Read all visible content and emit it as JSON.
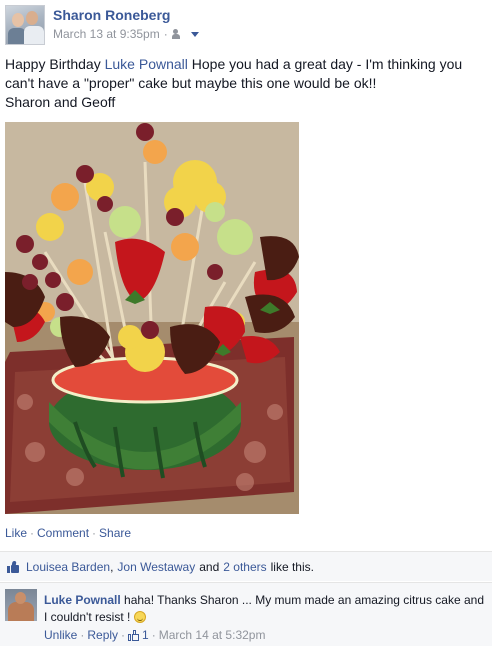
{
  "post": {
    "author": "Sharon Roneberg",
    "timestamp": "March 13 at 9:35pm",
    "audience_icon": "friends-icon",
    "text_before_tag": "Happy Birthday ",
    "tagged_user": "Luke Pownall",
    "text_after_tag": " Hope you had a great day - I'm thinking you can't have a \"proper\" cake but maybe this one would be ok!!",
    "signature": "Sharon and Geoff",
    "photo_description_icon": "fruit-bouquet-photo"
  },
  "actions": {
    "like": "Like",
    "comment": "Comment",
    "share": "Share",
    "separator": "·"
  },
  "likes": {
    "user1": "Louisea Barden",
    "comma": ",",
    "user2": "Jon Westaway",
    "and": "and",
    "others": "2 others",
    "suffix": "like this."
  },
  "comment": {
    "author": "Luke Pownall",
    "text": "haha! Thanks Sharon ... My mum made an amazing citrus cake and I couldn't resist !",
    "unlike": "Unlike",
    "reply": "Reply",
    "like_count": "1",
    "timestamp": "March 14 at 5:32pm",
    "separator": "·"
  },
  "colors": {
    "link": "#3b5998",
    "meta": "#90949c",
    "panel_bg": "#f6f7f9"
  }
}
